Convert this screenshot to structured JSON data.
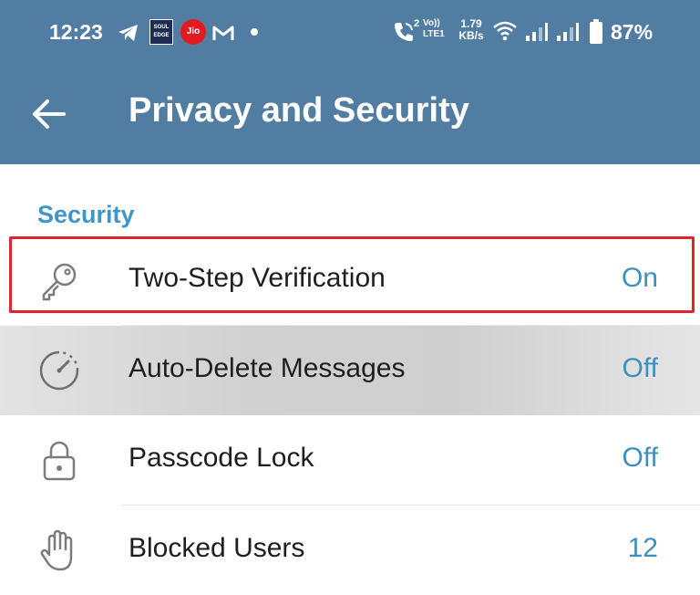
{
  "status_bar": {
    "time": "12:23",
    "net_speed_value": "1.79",
    "net_speed_unit": "KB/s",
    "volte_top": "Vo))",
    "volte_bottom": "LTE1",
    "call_sim": "2",
    "battery_percent": "87%",
    "notification_icons": [
      "telegram-icon",
      "soul-edge-app-icon",
      "jio-icon",
      "gmail-icon",
      "more-dot-icon"
    ],
    "jio_badge": "Jio",
    "soul_edge_badge": "SOUL EDGE"
  },
  "toolbar": {
    "title": "Privacy and Security",
    "back_icon": "arrow-left-icon"
  },
  "section": {
    "title": "Security"
  },
  "rows": [
    {
      "label": "Two-Step Verification",
      "value": "On",
      "icon": "key-icon"
    },
    {
      "label": "Auto-Delete Messages",
      "value": "Off",
      "icon": "timer-icon"
    },
    {
      "label": "Passcode Lock",
      "value": "Off",
      "icon": "lock-icon"
    },
    {
      "label": "Blocked Users",
      "value": "12",
      "icon": "hand-icon"
    }
  ],
  "colors": {
    "appbar": "#527da3",
    "accent": "#3d8fc0",
    "highlight_border": "#e0232e"
  }
}
